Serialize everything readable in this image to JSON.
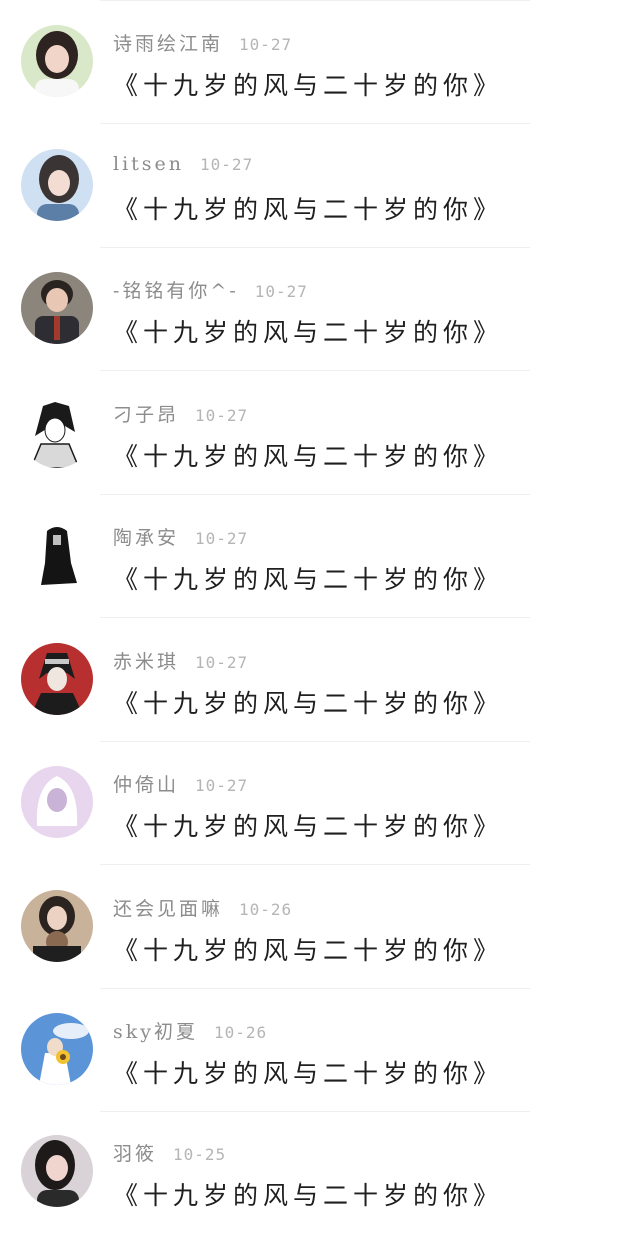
{
  "comments": [
    {
      "username": "诗雨绘江南",
      "date": "10-27",
      "song_title": "《十九岁的风与二十岁的你》",
      "avatar_icon": "girl-photo-avatar-icon",
      "avatar_colors": [
        "#d9e8c8",
        "#2d2320",
        "#f1d5c8"
      ]
    },
    {
      "username": "litsen",
      "date": "10-27",
      "song_title": "《十九岁的风与二十岁的你》",
      "avatar_icon": "girl-photo-avatar-icon",
      "avatar_colors": [
        "#cfe0f2",
        "#3b3434",
        "#f3dcd2"
      ]
    },
    {
      "username": "-铭铭有你^-",
      "date": "10-27",
      "song_title": "《十九岁的风与二十岁的你》",
      "avatar_icon": "boy-uniform-avatar-icon",
      "avatar_colors": [
        "#8b857c",
        "#2a2420",
        "#a33a2e"
      ]
    },
    {
      "username": "刁子昂",
      "date": "10-27",
      "song_title": "《十九岁的风与二十岁的你》",
      "avatar_icon": "anime-boy-sketch-avatar-icon",
      "avatar_colors": [
        "#ffffff",
        "#1a1a1a",
        "#d9d9d9"
      ]
    },
    {
      "username": "陶承安",
      "date": "10-27",
      "song_title": "《十九岁的风与二十岁的你》",
      "avatar_icon": "anime-girl-silhouette-avatar-icon",
      "avatar_colors": [
        "#ffffff",
        "#141414",
        "#bfbfbf"
      ]
    },
    {
      "username": "赤米琪",
      "date": "10-27",
      "song_title": "《十九岁的风与二十岁的你》",
      "avatar_icon": "anime-red-cloud-avatar-icon",
      "avatar_colors": [
        "#b82f2f",
        "#1c1c1c",
        "#f0e6e0"
      ]
    },
    {
      "username": "仲倚山",
      "date": "10-27",
      "song_title": "《十九岁的风与二十岁的你》",
      "avatar_icon": "anime-pastel-avatar-icon",
      "avatar_colors": [
        "#e8d6ee",
        "#ffffff",
        "#c9b3d6"
      ]
    },
    {
      "username": "还会见面嘛",
      "date": "10-26",
      "song_title": "《十九岁的风与二十岁的你》",
      "avatar_icon": "girl-bear-photo-avatar-icon",
      "avatar_colors": [
        "#c9b29a",
        "#2b231f",
        "#8a6a50"
      ]
    },
    {
      "username": "sky初夏",
      "date": "10-26",
      "song_title": "《十九岁的风与二十岁的你》",
      "avatar_icon": "anime-sunflower-sky-avatar-icon",
      "avatar_colors": [
        "#5b95d8",
        "#ffffff",
        "#f2c230"
      ]
    },
    {
      "username": "羽筱",
      "date": "10-25",
      "song_title": "《十九岁的风与二十岁的你》",
      "avatar_icon": "girl-photo-avatar-icon",
      "avatar_colors": [
        "#d9d2d6",
        "#1e1a1a",
        "#f0d5cf"
      ]
    }
  ]
}
